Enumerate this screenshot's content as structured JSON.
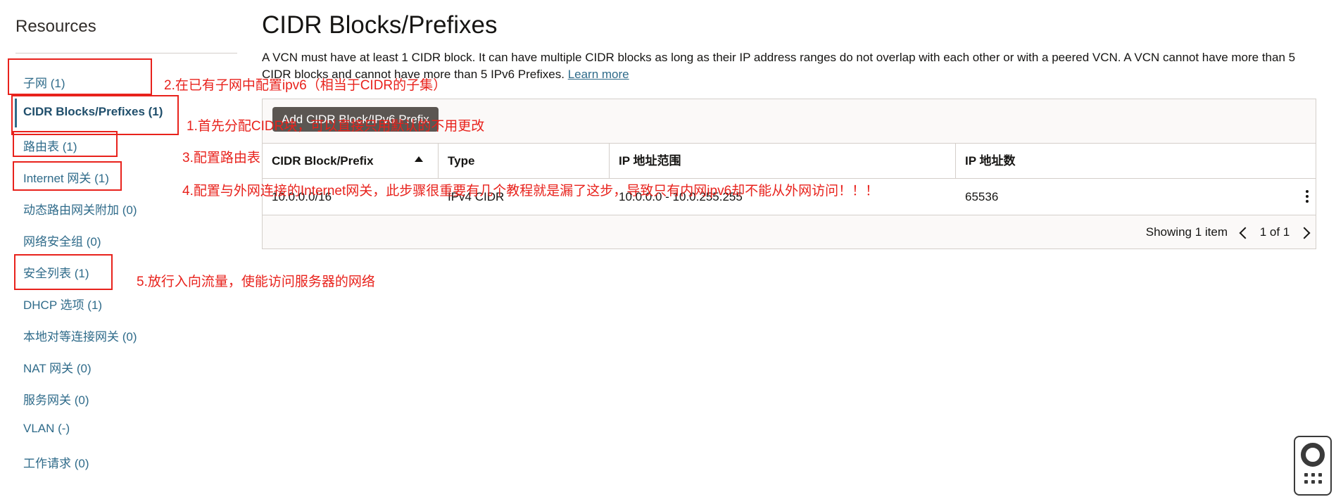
{
  "sidebar": {
    "title": "Resources",
    "items": [
      {
        "label": "子网 (1)"
      },
      {
        "label": "CIDR Blocks/Prefixes (1)"
      },
      {
        "label": "路由表 (1)"
      },
      {
        "label": "Internet 网关 (1)"
      },
      {
        "label": "动态路由网关附加 (0)"
      },
      {
        "label": "网络安全组 (0)"
      },
      {
        "label": "安全列表 (1)"
      },
      {
        "label": "DHCP 选项 (1)"
      },
      {
        "label": "本地对等连接网关 (0)"
      },
      {
        "label": "NAT 网关 (0)"
      },
      {
        "label": "服务网关 (0)"
      },
      {
        "label": "VLAN (-)"
      },
      {
        "label": "工作请求 (0)"
      }
    ]
  },
  "main": {
    "title": "CIDR Blocks/Prefixes",
    "description": "A VCN must have at least 1 CIDR block. It can have multiple CIDR blocks as long as their IP address ranges do not overlap with each other or with a peered VCN. A VCN cannot have more than 5 CIDR blocks and cannot have more than 5 IPv6 Prefixes.",
    "learn_more": "Learn more",
    "add_button": "Add CIDR Block/IPv6 Prefix",
    "columns": [
      "CIDR Block/Prefix",
      "Type",
      "IP 地址范围",
      "IP 地址数"
    ],
    "rows": [
      {
        "cidr": "10.0.0.0/16",
        "type": "IPv4 CIDR",
        "range": "10.0.0.0 - 10.0.255.255",
        "count": "65536"
      }
    ],
    "showing": "Showing 1 item",
    "page": "1 of 1"
  },
  "annotations": {
    "a1": "1.首先分配CIDR块，可以直接只用默认的不用更改",
    "a2": "2.在已有子网中配置ipv6（相当于CIDR的子集）",
    "a3": "3.配置路由表",
    "a4": "4.配置与外网连接的Internet网关，此步骤很重要有几个教程就是漏了这步，导致只有内网ipv6却不能从外网访问！！！",
    "a5": "5.放行入向流量，使能访问服务器的网络"
  },
  "colors": {
    "link": "#2f6b8a",
    "annotation": "#e8221c",
    "button": "#5b5652"
  }
}
